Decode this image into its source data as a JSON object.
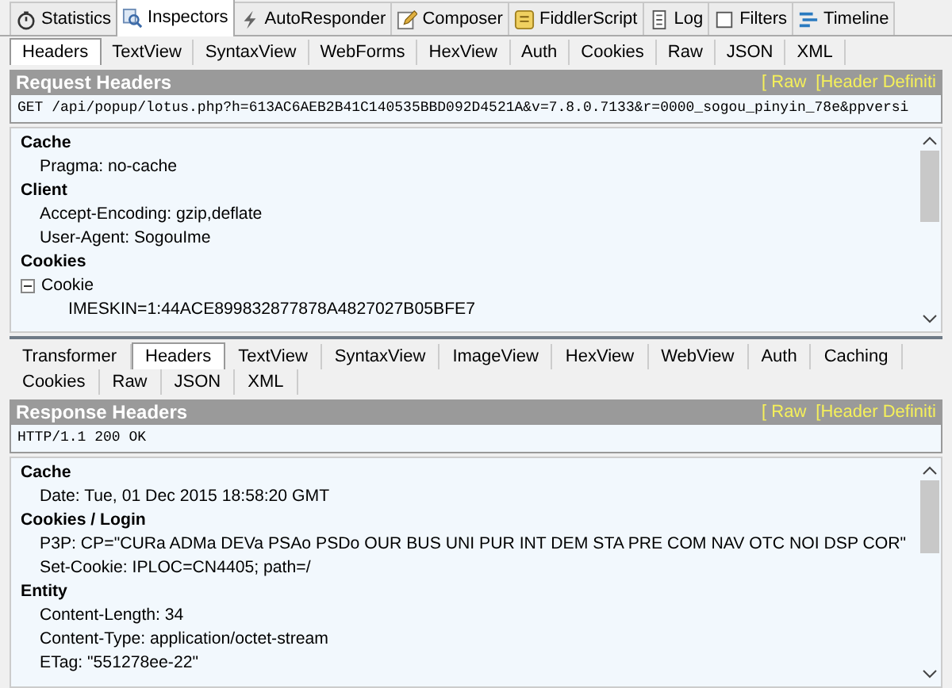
{
  "main_tabs": [
    {
      "label": "Statistics",
      "selected": false
    },
    {
      "label": "Inspectors",
      "selected": true
    },
    {
      "label": "AutoResponder",
      "selected": false
    },
    {
      "label": "Composer",
      "selected": false
    },
    {
      "label": "FiddlerScript",
      "selected": false
    },
    {
      "label": "Log",
      "selected": false
    },
    {
      "label": "Filters",
      "selected": false
    },
    {
      "label": "Timeline",
      "selected": false
    }
  ],
  "request": {
    "tabs": [
      {
        "label": "Headers",
        "selected": true
      },
      {
        "label": "TextView",
        "selected": false
      },
      {
        "label": "SyntaxView",
        "selected": false
      },
      {
        "label": "WebForms",
        "selected": false
      },
      {
        "label": "HexView",
        "selected": false
      },
      {
        "label": "Auth",
        "selected": false
      },
      {
        "label": "Cookies",
        "selected": false
      },
      {
        "label": "Raw",
        "selected": false
      },
      {
        "label": "JSON",
        "selected": false
      },
      {
        "label": "XML",
        "selected": false
      }
    ],
    "title": "Request Headers",
    "links": [
      "[ Raw",
      "[Header Definiti"
    ],
    "first_line": "GET /api/popup/lotus.php?h=613AC6AEB2B41C140535BBD092D4521A&v=7.8.0.7133&r=0000_sogou_pinyin_78e&ppversi",
    "sections": [
      {
        "name": "Cache",
        "items": [
          {
            "text": "Pragma: no-cache"
          }
        ]
      },
      {
        "name": "Client",
        "items": [
          {
            "text": "Accept-Encoding: gzip,deflate"
          },
          {
            "text": "User-Agent: SogouIme"
          }
        ]
      },
      {
        "name": "Cookies",
        "items": [
          {
            "text": "Cookie",
            "expanded": true,
            "children": [
              {
                "text": "IMESKIN=1:44ACE899832877878A4827027B05BFE7"
              }
            ]
          }
        ]
      }
    ]
  },
  "response": {
    "tabs": [
      {
        "label": "Transformer",
        "selected": false
      },
      {
        "label": "Headers",
        "selected": true
      },
      {
        "label": "TextView",
        "selected": false
      },
      {
        "label": "SyntaxView",
        "selected": false
      },
      {
        "label": "ImageView",
        "selected": false
      },
      {
        "label": "HexView",
        "selected": false
      },
      {
        "label": "WebView",
        "selected": false
      },
      {
        "label": "Auth",
        "selected": false
      },
      {
        "label": "Caching",
        "selected": false
      },
      {
        "label": "Cookies",
        "selected": false
      },
      {
        "label": "Raw",
        "selected": false
      },
      {
        "label": "JSON",
        "selected": false
      },
      {
        "label": "XML",
        "selected": false
      }
    ],
    "title": "Response Headers",
    "links": [
      "[ Raw",
      "[Header Definiti"
    ],
    "first_line": "HTTP/1.1 200 OK",
    "sections": [
      {
        "name": "Cache",
        "items": [
          {
            "text": "Date: Tue, 01 Dec 2015 18:58:20 GMT"
          }
        ]
      },
      {
        "name": "Cookies / Login",
        "items": [
          {
            "text": "P3P: CP=\"CURa ADMa DEVa PSAo PSDo OUR BUS UNI PUR INT DEM STA PRE COM NAV OTC NOI DSP COR\""
          },
          {
            "text": "Set-Cookie: IPLOC=CN4405; path=/"
          }
        ]
      },
      {
        "name": "Entity",
        "items": [
          {
            "text": "Content-Length: 34"
          },
          {
            "text": "Content-Type: application/octet-stream"
          },
          {
            "text": "ETag: \"551278ee-22\""
          }
        ]
      }
    ]
  }
}
